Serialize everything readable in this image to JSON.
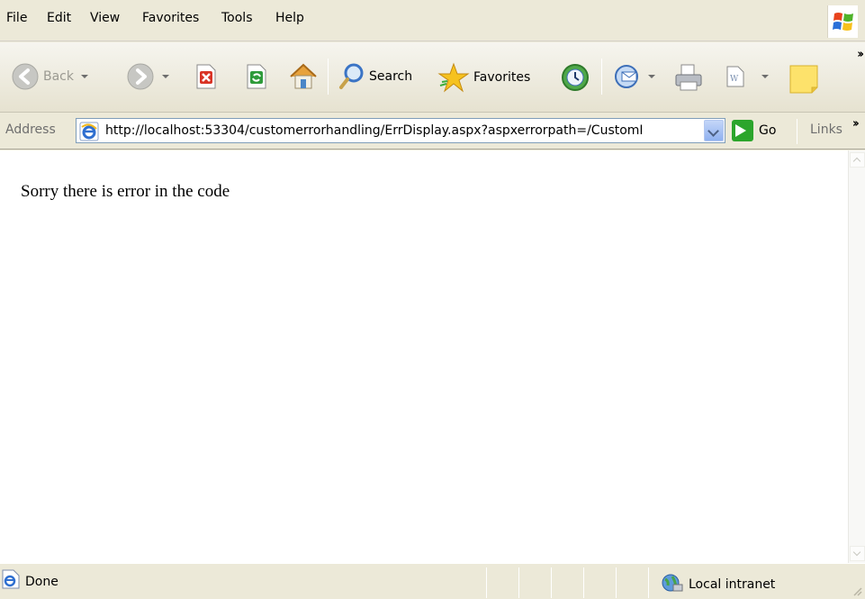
{
  "menu": {
    "items": [
      "File",
      "Edit",
      "View",
      "Favorites",
      "Tools",
      "Help"
    ]
  },
  "toolbar": {
    "back_label": "Back",
    "search_label": "Search",
    "favorites_label": "Favorites",
    "icons": [
      "back-arrow-icon",
      "forward-arrow-icon",
      "stop-icon",
      "refresh-icon",
      "home-icon",
      "search-icon",
      "favorites-star-icon",
      "history-icon",
      "mail-icon",
      "print-icon",
      "word-edit-icon",
      "notes-icon"
    ]
  },
  "address": {
    "label": "Address",
    "url": "http://localhost:53304/customerrorhandling/ErrDisplay.aspx?aspxerrorpath=/CustomI",
    "go_label": "Go",
    "links_label": "Links"
  },
  "page": {
    "error_message": "Sorry there is error in the code"
  },
  "status": {
    "text": "Done",
    "zone_label": "Local intranet"
  },
  "colors": {
    "chrome": "#ece9d8",
    "content_bg": "#ffffff",
    "address_border": "#7f9db9"
  }
}
